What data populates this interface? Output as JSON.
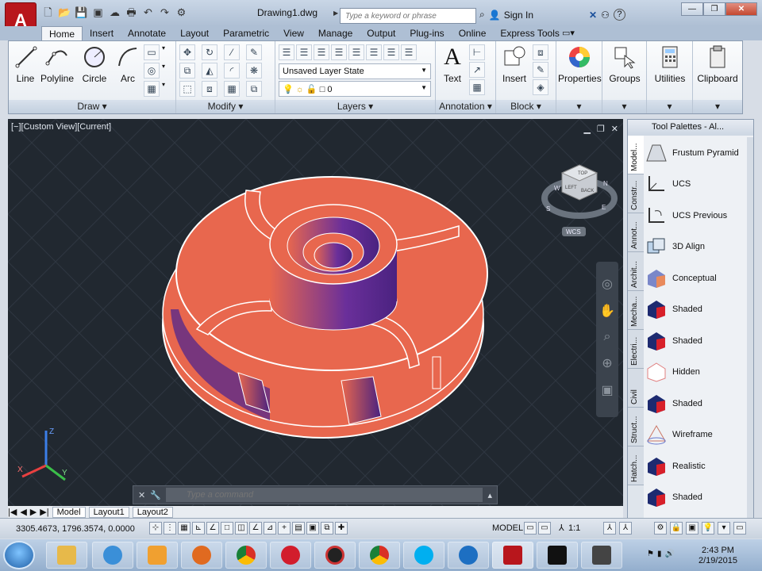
{
  "title_bar": {
    "app_button": "A",
    "document_title": "Drawing1.dwg",
    "search_placeholder": "Type a keyword or phrase",
    "sign_in": "Sign In",
    "help": "?",
    "minimize": "—",
    "restore": "❐",
    "close": "✕"
  },
  "tabs": [
    "Home",
    "Insert",
    "Annotate",
    "Layout",
    "Parametric",
    "View",
    "Manage",
    "Output",
    "Plug-ins",
    "Online",
    "Express Tools"
  ],
  "tab_extra": "▭▾",
  "ribbon": {
    "draw": {
      "title": "Draw ▾",
      "line": "Line",
      "polyline": "Polyline",
      "circle": "Circle",
      "arc": "Arc"
    },
    "modify": {
      "title": "Modify ▾"
    },
    "layers": {
      "title": "Layers ▾",
      "layer_state": "Unsaved Layer State",
      "current_layer": "0"
    },
    "annotation": {
      "title": "Annotation ▾",
      "text": "Text"
    },
    "block": {
      "title": "Block ▾",
      "insert": "Insert"
    },
    "properties": "Properties",
    "groups": "Groups",
    "utilities": "Utilities",
    "clipboard": "Clipboard"
  },
  "viewport": {
    "label": "[−][Custom View][Current]",
    "wcs": "WCS",
    "viewcube_faces": [
      "TOP",
      "BACK",
      "LEFT"
    ],
    "compass": [
      "N",
      "E",
      "S",
      "W"
    ],
    "axes": [
      "X",
      "Y",
      "Z"
    ],
    "command_placeholder": "Type a command"
  },
  "layout_tabs": [
    "Model",
    "Layout1",
    "Layout2"
  ],
  "palette": {
    "title": "Tool Palettes - Al...",
    "side_tabs": [
      "Model...",
      "Constr...",
      "Annot...",
      "Archit...",
      "Mecha...",
      "Electri...",
      "Civil",
      "Struct...",
      "Hatch..."
    ],
    "items": [
      "Frustum Pyramid",
      "UCS",
      "UCS Previous",
      "3D Align",
      "Conceptual",
      "Shaded",
      "Shaded",
      "Hidden",
      "Shaded",
      "Wireframe",
      "Realistic",
      "Shaded"
    ]
  },
  "status": {
    "coords": "3305.4673, 1796.3574, 0.0000",
    "model": "MODEL",
    "scale": "1:1"
  },
  "taskbar": {
    "time": "2:43 PM",
    "date": "2/19/2015"
  },
  "colors": {
    "impeller_face": "#e8674e",
    "impeller_shadow": "#5a2a8a",
    "viewport_bg": "#212830",
    "ribbon_accent": "#b8161c"
  }
}
